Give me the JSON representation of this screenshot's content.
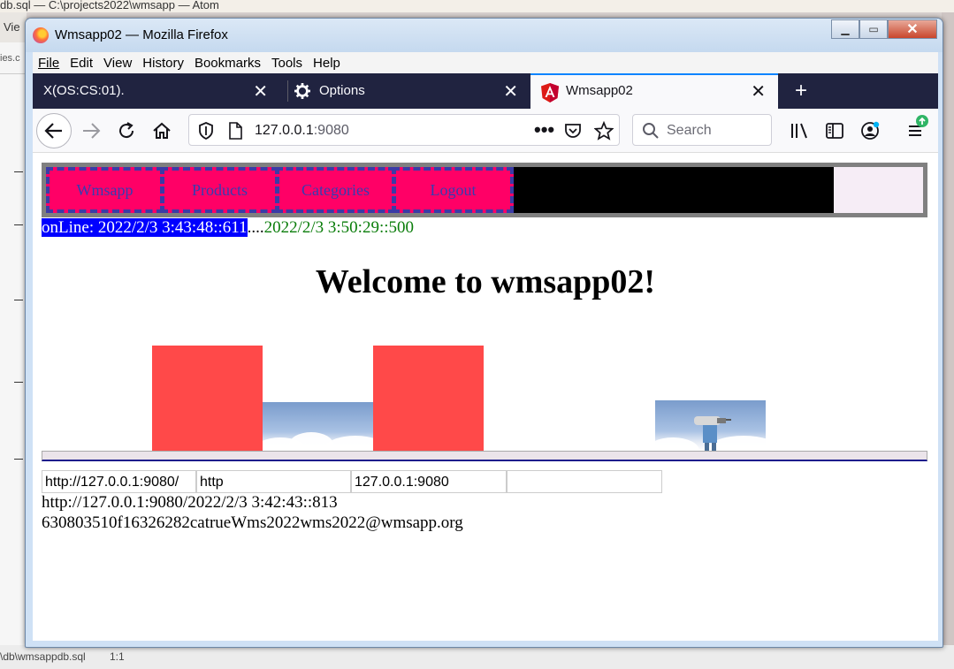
{
  "background": {
    "titlebar_text": "db.sql — C:\\projects2022\\wmsapp — Atom",
    "menu_text": "Vie",
    "tab_text": "ies.c",
    "status_file": "\\db\\wmsappdb.sql",
    "status_pos": "1:1"
  },
  "window": {
    "title": "Wmsapp02 — Mozilla Firefox",
    "menu": [
      "File",
      "Edit",
      "View",
      "History",
      "Bookmarks",
      "Tools",
      "Help"
    ]
  },
  "tabs": [
    {
      "label": "X(OS:CS:01)."
    },
    {
      "label": "Options"
    },
    {
      "label": "Wmsapp02"
    }
  ],
  "urlbar": {
    "host": "127.0.0.1",
    "port": ":9080"
  },
  "search": {
    "placeholder": "Search"
  },
  "app": {
    "nav": [
      "Wmsapp",
      "Products",
      "Categories",
      "Logout"
    ],
    "online_label": "onLine: 2022/2/3 3:43:48::611",
    "dots": "....",
    "time_now": "2022/2/3 3:50:29::500",
    "welcome": "Welcome to wmsapp02!",
    "fields": [
      "http://127.0.0.1:9080/",
      "http",
      "127.0.0.1:9080",
      ""
    ],
    "line1": "http://127.0.0.1:9080/2022/2/3 3:42:43::813",
    "line2": "630803510f16326282catrueWms2022wms2022@wmsapp.org"
  },
  "colors": {
    "nav_item_bg": "#ff0066",
    "online_bg": "#0000ff",
    "time_green": "#0a7d0a",
    "red_box": "#ff4949"
  }
}
